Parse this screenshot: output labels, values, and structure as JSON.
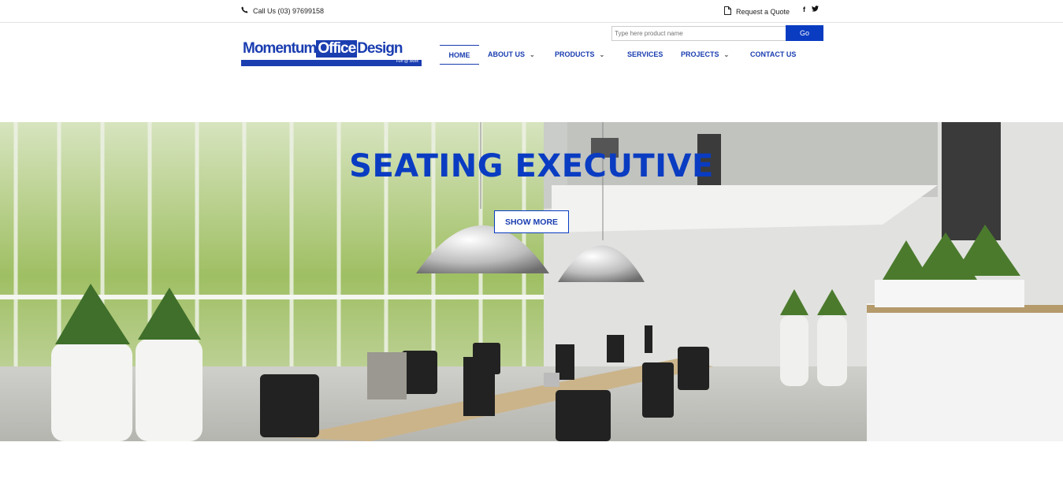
{
  "topbar": {
    "call_text": "Call Us (03) 97699158",
    "quote_text": "Request a Quote",
    "social": [
      "f",
      "twitter"
    ]
  },
  "search": {
    "placeholder": "Type here product name",
    "button_label": "Go"
  },
  "logo": {
    "word1": "Momentum",
    "word2": "Office",
    "word3": "Design",
    "tagline": "Fun @ Work"
  },
  "nav": {
    "items": [
      {
        "label": "HOME",
        "active": true,
        "dropdown": false
      },
      {
        "label": "ABOUT US",
        "active": false,
        "dropdown": true
      },
      {
        "label": "PRODUCTS",
        "active": false,
        "dropdown": true
      },
      {
        "label": "SERVICES",
        "active": false,
        "dropdown": false
      },
      {
        "label": "PROJECTS",
        "active": false,
        "dropdown": true
      },
      {
        "label": "CONTACT US",
        "active": false,
        "dropdown": false
      }
    ]
  },
  "hero": {
    "title": "SEATING EXECUTIVE",
    "button_label": "SHOW MORE"
  },
  "colors": {
    "brand_blue": "#0a3cc2",
    "nav_blue": "#1a3db0"
  }
}
